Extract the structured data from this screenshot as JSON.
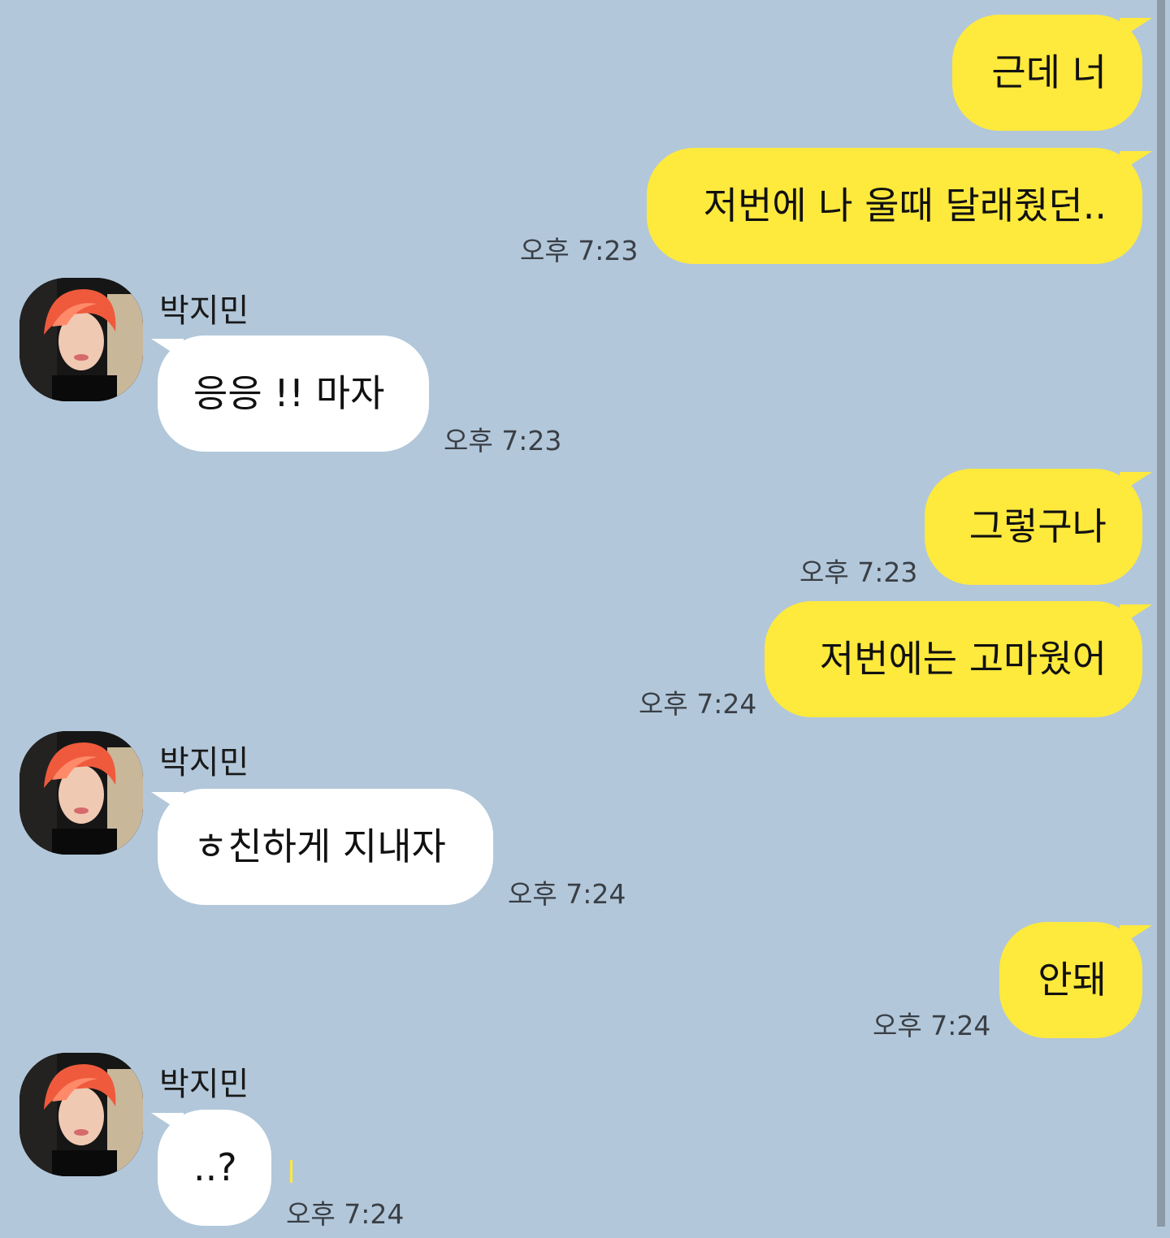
{
  "theme": {
    "background": "#b2c7da",
    "my_bubble": "#fee93d",
    "their_bubble": "#ffffff",
    "scrollbar": "#8d9aa6"
  },
  "sender_name": "박지민",
  "messages": [
    {
      "from": "me",
      "text": "근데 너",
      "time": ""
    },
    {
      "from": "me",
      "text": "저번에 나 울때 달래줬던..",
      "time": "오후 7:23"
    },
    {
      "from": "them",
      "text": "응응 !! 마자",
      "time": "오후 7:23"
    },
    {
      "from": "me",
      "text": "그렇구나",
      "time": "오후 7:23"
    },
    {
      "from": "me",
      "text": "저번에는 고마웠어",
      "time": "오후 7:24"
    },
    {
      "from": "them",
      "text": "ㅎ친하게 지내자",
      "time": "오후 7:24"
    },
    {
      "from": "me",
      "text": "안돼",
      "time": "오후 7:24"
    },
    {
      "from": "them",
      "text": "..?",
      "time": "오후 7:24"
    }
  ],
  "icons": {
    "avatar": "profile-photo-icon"
  }
}
